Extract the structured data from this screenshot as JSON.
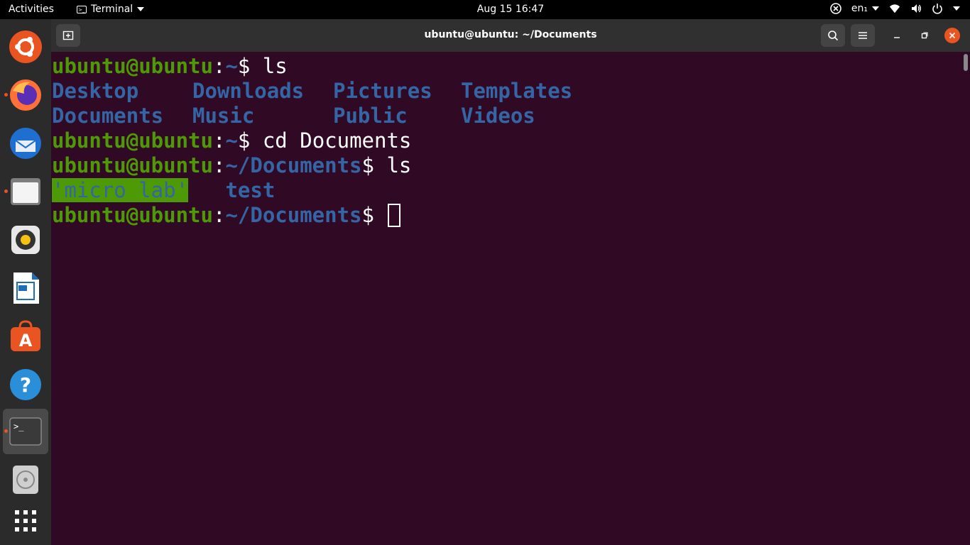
{
  "topbar": {
    "activities": "Activities",
    "app_name": "Terminal",
    "clock": "Aug 15  16:47",
    "lang": "en₁"
  },
  "dock": {
    "items": [
      {
        "name": "ubuntu-logo-icon"
      },
      {
        "name": "firefox-icon"
      },
      {
        "name": "thunderbird-icon"
      },
      {
        "name": "files-icon"
      },
      {
        "name": "rhythmbox-icon"
      },
      {
        "name": "libreoffice-writer-icon"
      },
      {
        "name": "software-center-icon"
      },
      {
        "name": "help-icon"
      },
      {
        "name": "terminal-icon"
      },
      {
        "name": "optical-drive-icon"
      },
      {
        "name": "show-applications-icon"
      }
    ]
  },
  "window": {
    "title": "ubuntu@ubuntu: ~/Documents"
  },
  "terminal": {
    "user_host": "ubuntu@ubuntu",
    "colon": ":",
    "home_path": "~",
    "docs_path": "~/Documents",
    "prompt_sign": "$",
    "cmd_ls": " ls",
    "cmd_cd": " cd Documents",
    "home_listing": {
      "row1": [
        "Desktop",
        "Downloads",
        "Pictures",
        "Templates"
      ],
      "row2": [
        "Documents",
        "Music",
        "Public",
        "Videos"
      ]
    },
    "docs_listing": [
      "'micro lab'",
      "test"
    ]
  },
  "colors": {
    "terminal_bg": "#300a24",
    "prompt_green": "#4e9a06",
    "dir_blue": "#3465a4",
    "accent_orange": "#e95420"
  }
}
